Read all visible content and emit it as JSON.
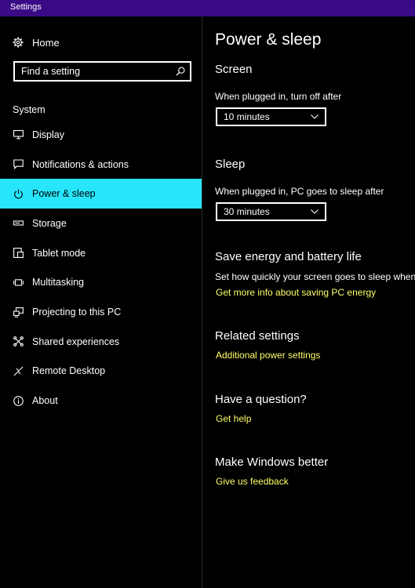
{
  "window": {
    "title": "Settings"
  },
  "sidebar": {
    "home_label": "Home",
    "search_placeholder": "Find a setting",
    "section_label": "System",
    "items": [
      {
        "label": "Display",
        "icon": "monitor-icon"
      },
      {
        "label": "Notifications & actions",
        "icon": "notification-icon"
      },
      {
        "label": "Power & sleep",
        "icon": "power-icon",
        "active": true
      },
      {
        "label": "Storage",
        "icon": "storage-icon"
      },
      {
        "label": "Tablet mode",
        "icon": "tablet-icon"
      },
      {
        "label": "Multitasking",
        "icon": "multitasking-icon"
      },
      {
        "label": "Projecting to this PC",
        "icon": "projecting-icon"
      },
      {
        "label": "Shared experiences",
        "icon": "shared-experiences-icon"
      },
      {
        "label": "Remote Desktop",
        "icon": "remote-desktop-icon"
      },
      {
        "label": "About",
        "icon": "info-icon"
      }
    ]
  },
  "main": {
    "title": "Power & sleep",
    "screen": {
      "heading": "Screen",
      "label": "When plugged in, turn off after",
      "value": "10 minutes"
    },
    "sleep": {
      "heading": "Sleep",
      "label": "When plugged in, PC goes to sleep after",
      "value": "30 minutes"
    },
    "save_energy": {
      "heading": "Save energy and battery life",
      "text": "Set how quickly your screen goes to sleep when y",
      "link": "Get more info about saving PC energy"
    },
    "related": {
      "heading": "Related settings",
      "link": "Additional power settings"
    },
    "question": {
      "heading": "Have a question?",
      "link": "Get help"
    },
    "feedback": {
      "heading": "Make Windows better",
      "link": "Give us feedback"
    }
  },
  "colors": {
    "title_bar": "#3a0a86",
    "accent": "#27e6fc",
    "link": "#ffff66",
    "background": "#000000"
  }
}
